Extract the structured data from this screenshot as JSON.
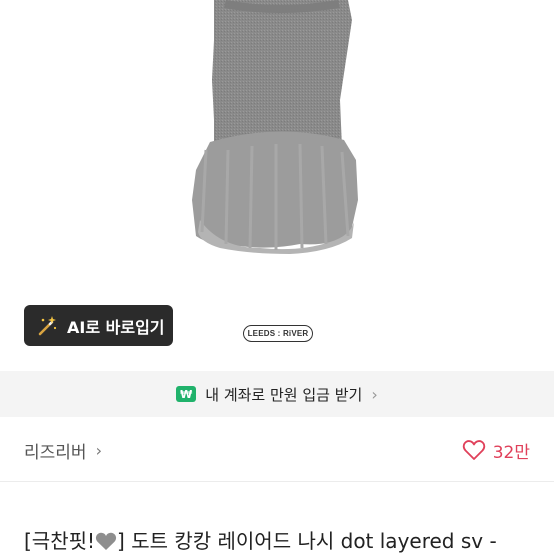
{
  "product": {
    "ai_button_label": "AI로 바로입기",
    "brand_logo_text": "LEEDS : RiVER",
    "title_prefix": "[극찬핏!",
    "title_rest": "] 도트 캉캉 레이어드 나시 dot layered sv -"
  },
  "banner": {
    "badge": "₩",
    "text": "내 계좌로 만원 입금 받기"
  },
  "shop": {
    "name": "리즈리버",
    "likes": "32만"
  },
  "icons": {
    "wand": "magic-wand-icon",
    "heart": "heart-outline-icon",
    "chevron": "chevron-right-icon"
  },
  "colors": {
    "accent_green": "#20b26b",
    "like_red": "#e0405a",
    "dark_button": "#2b2b2b"
  }
}
